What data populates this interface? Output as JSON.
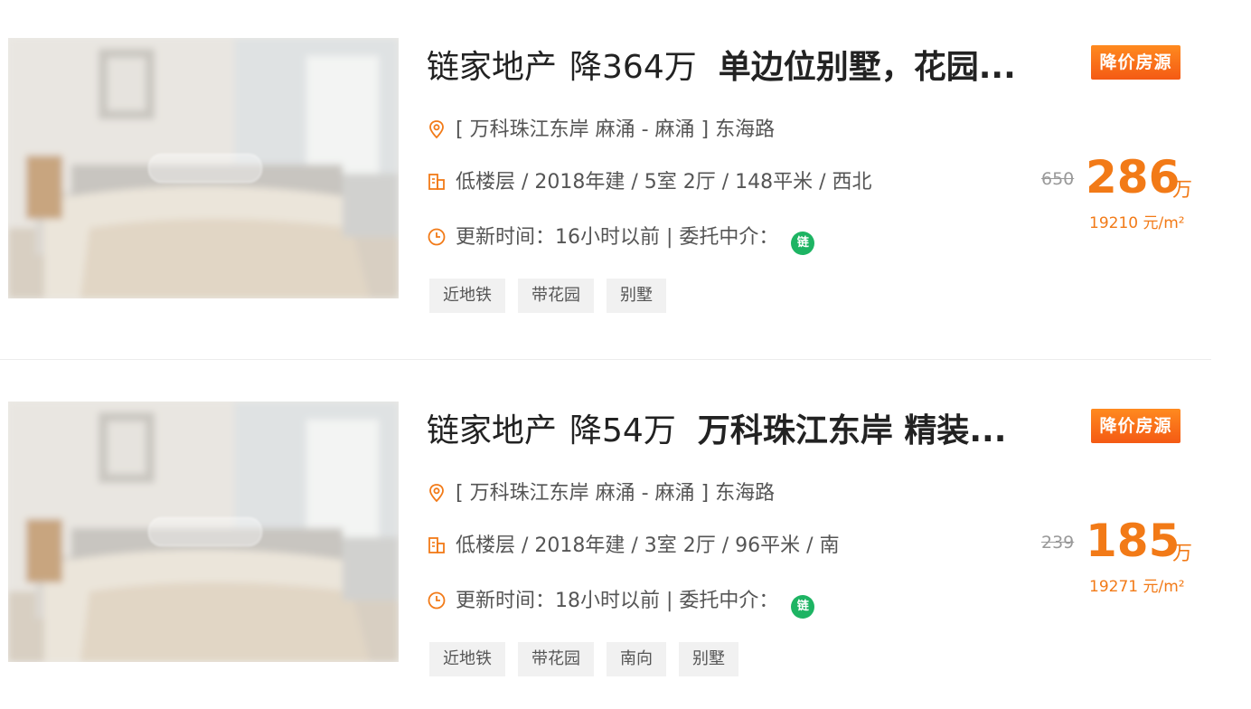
{
  "listings": [
    {
      "title_agency": "链家地产",
      "title_drop": "降364万",
      "title_desc": "单边位别墅，花园...",
      "badge": "降价房源",
      "location": "[ 万科珠江东岸 麻涌 - 麻涌 ] 东海路",
      "info": "低楼层 / 2018年建 / 5室 2厅 / 148平米 / 西北",
      "update": "更新时间：16小时以前 | 委托中介：",
      "agent_badge": "链",
      "tags": [
        "近地铁",
        "带花园",
        "别墅"
      ],
      "price_original": "650",
      "price_current": "286",
      "price_unit": "万",
      "price_per_sqm": "19210 元/m²"
    },
    {
      "title_agency": "链家地产",
      "title_drop": "降54万",
      "title_desc": "万科珠江东岸 精装...",
      "badge": "降价房源",
      "location": "[ 万科珠江东岸 麻涌 - 麻涌 ] 东海路",
      "info": "低楼层 / 2018年建 / 3室 2厅 / 96平米 / 南",
      "update": "更新时间：18小时以前 | 委托中介：",
      "agent_badge": "链",
      "tags": [
        "近地铁",
        "带花园",
        "南向",
        "别墅"
      ],
      "price_original": "239",
      "price_current": "185",
      "price_unit": "万",
      "price_per_sqm": "19271 元/m²"
    }
  ],
  "icons": {
    "location": "location-pin-icon",
    "building": "building-icon",
    "clock": "clock-icon"
  },
  "colors": {
    "accent": "#f27a17",
    "badge": "#f45a14",
    "agent": "#1db463"
  }
}
